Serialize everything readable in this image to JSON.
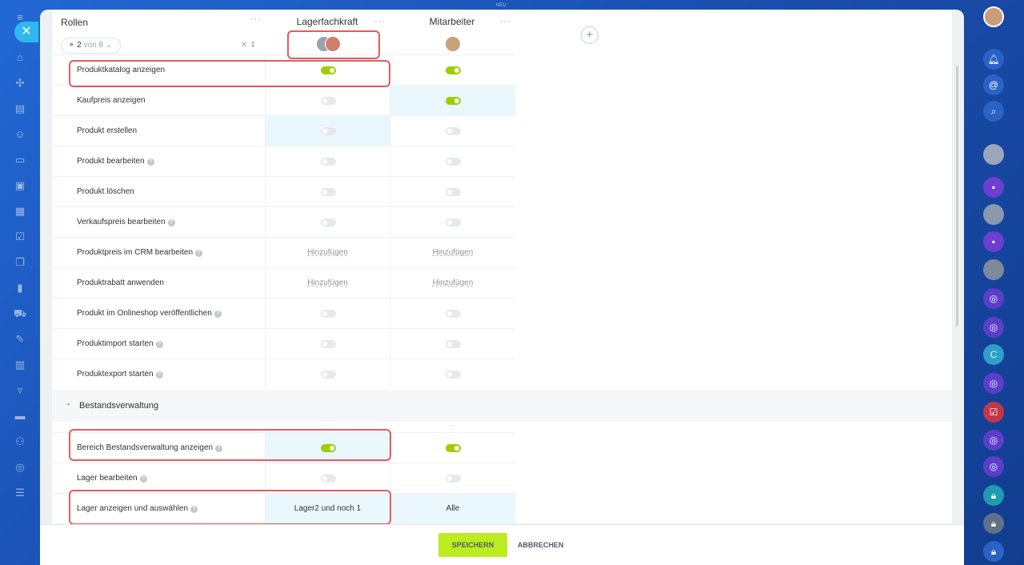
{
  "topbar": {
    "label": "NEU"
  },
  "header": {
    "roles_title": "Rollen",
    "selector_count": "2",
    "selector_suffix": "von 8",
    "more": "···"
  },
  "columns": [
    {
      "title": "Lagerfachkraft"
    },
    {
      "title": "Mitarbeiter"
    }
  ],
  "add_column_label": "+",
  "rows": [
    {
      "label": "Produktkatalog anzeigen",
      "help": false,
      "a": {
        "kind": "toggle",
        "on": true
      },
      "b": {
        "kind": "toggle",
        "on": true
      }
    },
    {
      "label": "Kaufpreis anzeigen",
      "help": false,
      "a": {
        "kind": "toggle",
        "on": false
      },
      "b": {
        "kind": "toggle",
        "on": true
      }
    },
    {
      "label": "Produkt erstellen",
      "help": false,
      "a": {
        "kind": "toggle",
        "on": false
      },
      "b": {
        "kind": "toggle",
        "on": false
      }
    },
    {
      "label": "Produkt bearbeiten",
      "help": true,
      "a": {
        "kind": "toggle",
        "on": false
      },
      "b": {
        "kind": "toggle",
        "on": false
      }
    },
    {
      "label": "Produkt löschen",
      "help": false,
      "a": {
        "kind": "toggle",
        "on": false
      },
      "b": {
        "kind": "toggle",
        "on": false
      }
    },
    {
      "label": "Verkaufspreis bearbeiten",
      "help": true,
      "a": {
        "kind": "toggle",
        "on": false
      },
      "b": {
        "kind": "toggle",
        "on": false
      }
    },
    {
      "label": "Produktpreis im CRM bearbeiten",
      "help": true,
      "a": {
        "kind": "link",
        "text": "Hinzufügen"
      },
      "b": {
        "kind": "link",
        "text": "Hinzufügen"
      }
    },
    {
      "label": "Produktrabatt anwenden",
      "help": false,
      "a": {
        "kind": "link",
        "text": "Hinzufügen"
      },
      "b": {
        "kind": "link",
        "text": "Hinzufügen"
      }
    },
    {
      "label": "Produkt im Onlineshop veröffentlichen",
      "help": true,
      "a": {
        "kind": "toggle",
        "on": false
      },
      "b": {
        "kind": "toggle",
        "on": false
      }
    },
    {
      "label": "Produktimport starten",
      "help": true,
      "a": {
        "kind": "toggle",
        "on": false
      },
      "b": {
        "kind": "toggle",
        "on": false
      }
    },
    {
      "label": "Produktexport starten",
      "help": true,
      "a": {
        "kind": "toggle",
        "on": false
      },
      "b": {
        "kind": "toggle",
        "on": false
      }
    }
  ],
  "section": {
    "title": "Bestandsverwaltung"
  },
  "section_rows": [
    {
      "label": "Bereich Bestandsverwaltung anzeigen",
      "help": true,
      "a": {
        "kind": "toggle",
        "on": true
      },
      "b": {
        "kind": "toggle",
        "on": true
      }
    },
    {
      "label": "Lager bearbeiten",
      "help": true,
      "a": {
        "kind": "toggle",
        "on": false
      },
      "b": {
        "kind": "toggle",
        "on": false
      }
    },
    {
      "label": "Lager anzeigen und auswählen",
      "help": true,
      "a": {
        "kind": "value",
        "text": "Lager2 und noch 1"
      },
      "b": {
        "kind": "value",
        "text": "Alle"
      }
    }
  ],
  "footer": {
    "save": "SPEICHERN",
    "cancel": "ABBRECHEN"
  },
  "right_rail_badge": "C",
  "colors": {
    "accent": "#bbed21",
    "toggle_on": "#9dcf00",
    "highlight": "#e25c5f",
    "close": "#2fb8f0"
  }
}
